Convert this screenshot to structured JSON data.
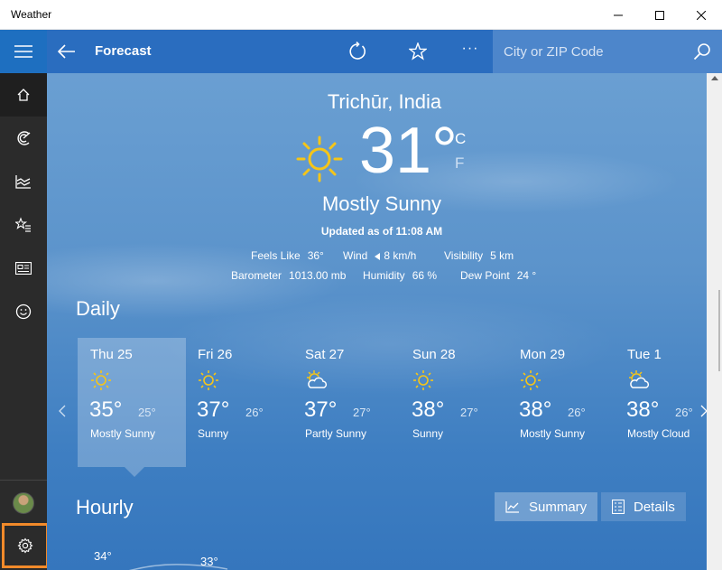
{
  "window": {
    "title": "Weather"
  },
  "header": {
    "title": "Forecast",
    "search_placeholder": "City or ZIP Code",
    "more_label": "···"
  },
  "sidebar": {
    "items": [
      {
        "name": "menu",
        "icon": "hamburger-icon"
      },
      {
        "name": "forecast",
        "icon": "home-icon"
      },
      {
        "name": "maps",
        "icon": "radar-icon"
      },
      {
        "name": "historical",
        "icon": "chart-icon"
      },
      {
        "name": "places",
        "icon": "star-list-icon"
      },
      {
        "name": "news",
        "icon": "news-icon"
      },
      {
        "name": "feedback",
        "icon": "smiley-icon"
      },
      {
        "name": "settings",
        "icon": "gear-icon"
      }
    ]
  },
  "current": {
    "location": "Trichūr, India",
    "temperature": "31°",
    "unit_c": "C",
    "unit_f": "F",
    "condition": "Mostly Sunny",
    "updated": "Updated as of 11:08 AM",
    "details": {
      "feels_like_label": "Feels Like",
      "feels_like": "36°",
      "wind_label": "Wind",
      "wind": "8 km/h",
      "visibility_label": "Visibility",
      "visibility": "5 km",
      "barometer_label": "Barometer",
      "barometer": "1013.00 mb",
      "humidity_label": "Humidity",
      "humidity": "66 %",
      "dew_point_label": "Dew Point",
      "dew_point": "24 °"
    }
  },
  "daily": {
    "title": "Daily",
    "days": [
      {
        "name": "Thu 25",
        "hi": "35°",
        "lo": "25°",
        "condition": "Mostly Sunny",
        "icon": "sun-icon"
      },
      {
        "name": "Fri 26",
        "hi": "37°",
        "lo": "26°",
        "condition": "Sunny",
        "icon": "sun-icon"
      },
      {
        "name": "Sat 27",
        "hi": "37°",
        "lo": "27°",
        "condition": "Partly Sunny",
        "icon": "partly-cloudy-icon"
      },
      {
        "name": "Sun 28",
        "hi": "38°",
        "lo": "27°",
        "condition": "Sunny",
        "icon": "sun-icon"
      },
      {
        "name": "Mon 29",
        "hi": "38°",
        "lo": "26°",
        "condition": "Mostly Sunny",
        "icon": "sun-icon"
      },
      {
        "name": "Tue 1",
        "hi": "38°",
        "lo": "26°",
        "condition": "Mostly Cloud",
        "icon": "partly-cloudy-icon"
      }
    ]
  },
  "hourly": {
    "title": "Hourly",
    "summary_label": "Summary",
    "details_label": "Details",
    "temps": [
      "34°",
      "33°"
    ]
  },
  "colors": {
    "header": "#2a6dbf",
    "sidebar": "#2b2b2b",
    "sun": "#f5c518",
    "settings_highlight": "#f28a2a"
  }
}
